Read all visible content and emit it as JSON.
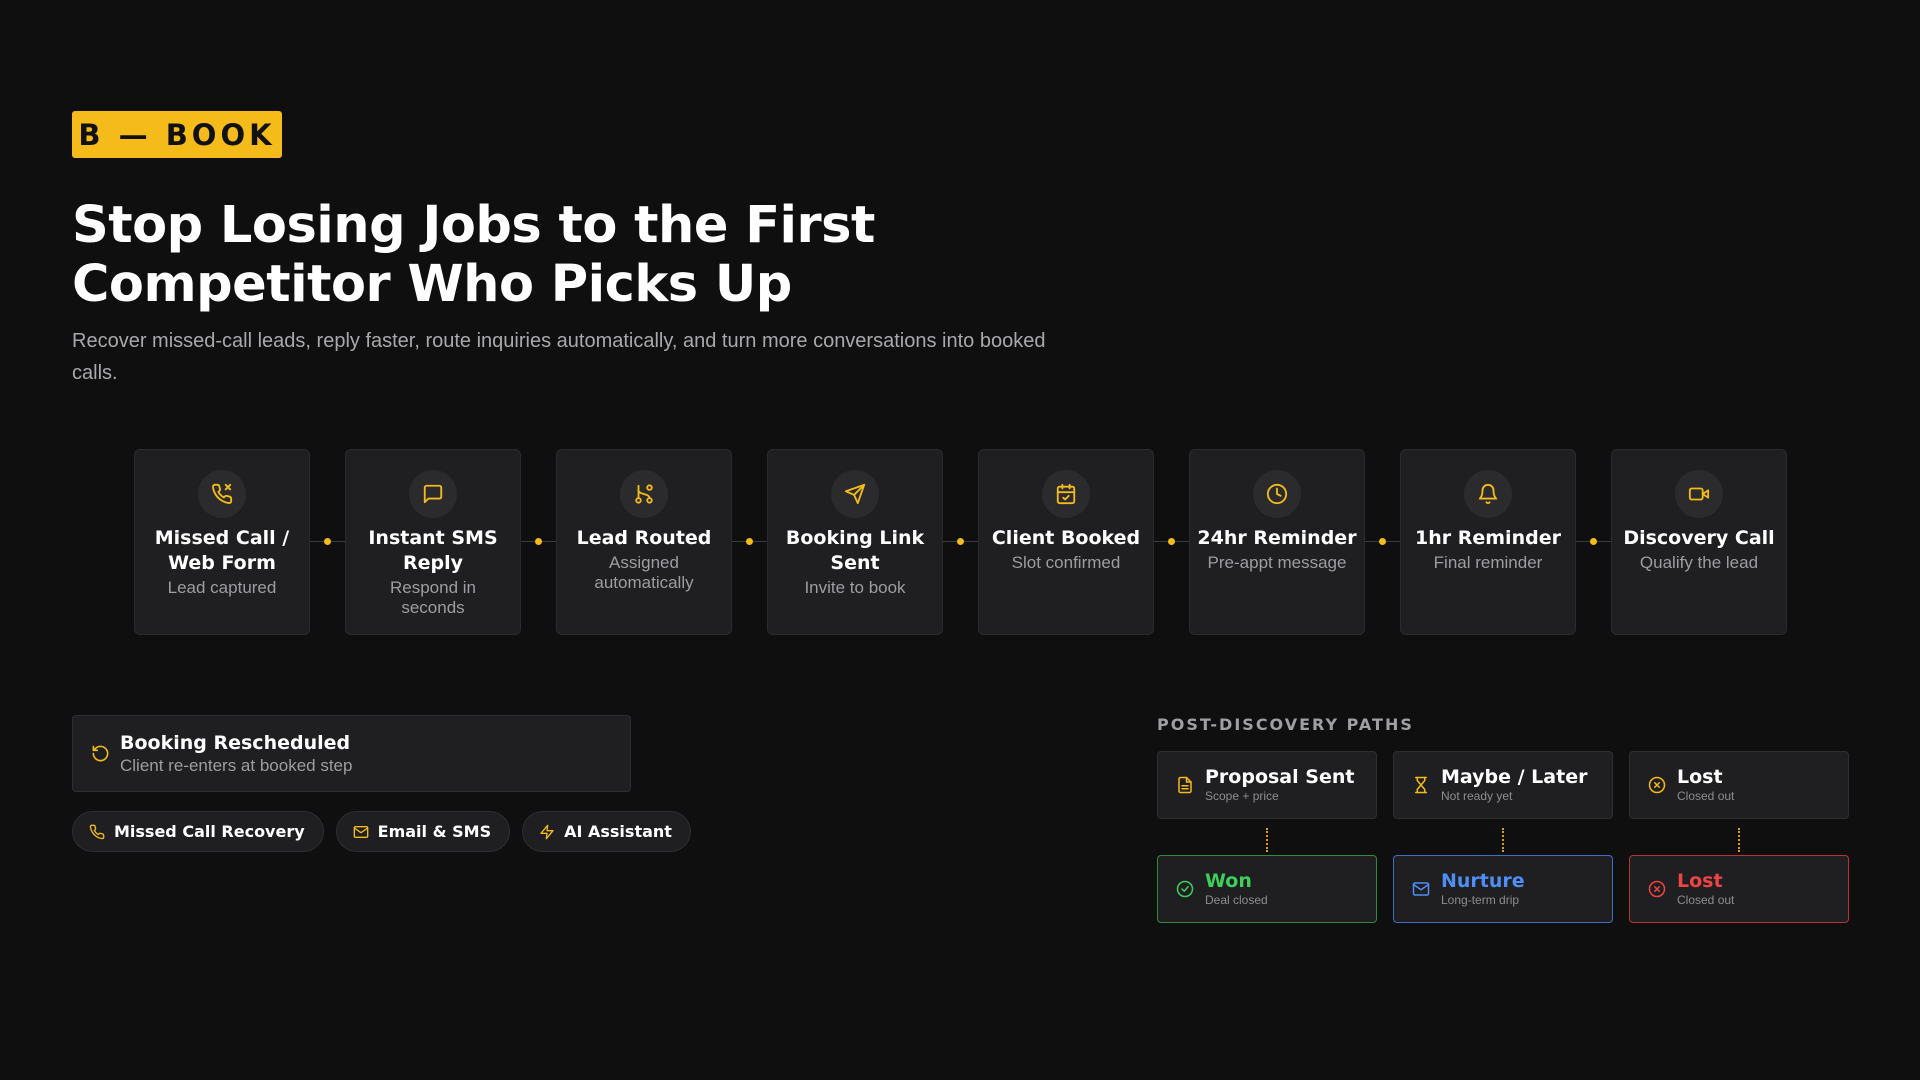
{
  "badge": "B — BOOK",
  "headline": {
    "line1": "Stop Losing Jobs to the First",
    "line2": "Competitor Who Picks Up"
  },
  "subtitle": "Recover missed-call leads, reply faster, route inquiries automatically, and turn more conversations into booked calls.",
  "colors": {
    "accent": "#f4bb1a",
    "won": "#3ecf5a",
    "nurture": "#4f8ef7",
    "lost": "#ef4444",
    "card": "#1f1f21"
  },
  "flow_steps": [
    {
      "icon": "phone-missed-icon",
      "title": "Missed Call / Web Form",
      "sub": "Lead captured"
    },
    {
      "icon": "message-square-icon",
      "title": "Instant SMS Reply",
      "sub": "Respond in seconds"
    },
    {
      "icon": "route-icon",
      "title": "Lead Routed",
      "sub": "Assigned automatically"
    },
    {
      "icon": "send-icon",
      "title": "Booking Link Sent",
      "sub": "Invite to book"
    },
    {
      "icon": "calendar-check-icon",
      "title": "Client Booked",
      "sub": "Slot confirmed"
    },
    {
      "icon": "clock-icon",
      "title": "24hr Reminder",
      "sub": "Pre-appt message"
    },
    {
      "icon": "bell-icon",
      "title": "1hr Reminder",
      "sub": "Final reminder"
    },
    {
      "icon": "video-icon",
      "title": "Discovery Call",
      "sub": "Qualify the lead"
    }
  ],
  "rescheduled": {
    "icon": "rotate-icon",
    "title": "Booking Rescheduled",
    "sub": "Client re-enters at booked step"
  },
  "pills": [
    {
      "icon": "phone-icon",
      "label": "Missed Call Recovery"
    },
    {
      "icon": "mail-icon",
      "label": "Email & SMS"
    },
    {
      "icon": "zap-icon",
      "label": "AI Assistant"
    }
  ],
  "post_discovery": {
    "label": "POST-DISCOVERY PATHS",
    "top": [
      {
        "icon": "file-icon",
        "title": "Proposal Sent",
        "sub": "Scope + price"
      },
      {
        "icon": "hourglass-icon",
        "title": "Maybe / Later",
        "sub": "Not ready yet"
      },
      {
        "icon": "x-circle-icon",
        "title": "Lost",
        "sub": "Closed out"
      }
    ],
    "bottom": [
      {
        "icon": "check-circle-icon",
        "title": "Won",
        "sub": "Deal closed"
      },
      {
        "icon": "mail-icon",
        "title": "Nurture",
        "sub": "Long-term drip"
      },
      {
        "icon": "x-circle-icon",
        "title": "Lost",
        "sub": "Closed out"
      }
    ]
  }
}
